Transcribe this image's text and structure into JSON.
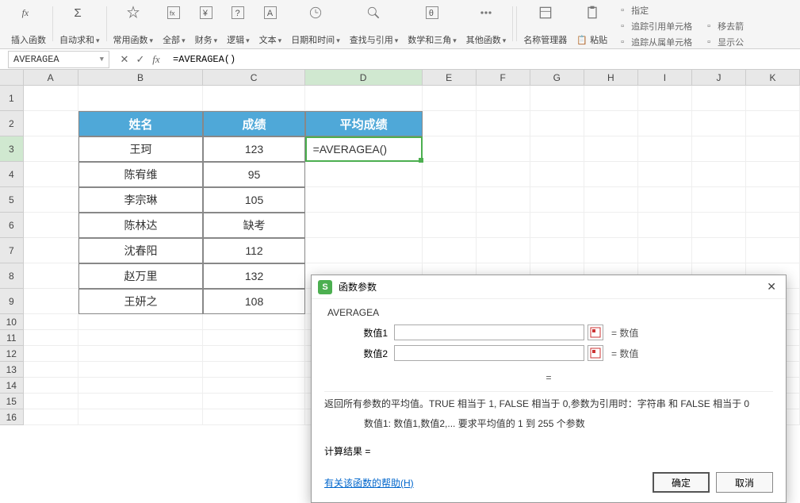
{
  "ribbon": {
    "items": [
      {
        "label": "插入函数",
        "icon": "fx"
      },
      {
        "label": "自动求和",
        "icon": "sigma",
        "drop": true
      },
      {
        "label": "常用函数",
        "icon": "star",
        "drop": true
      },
      {
        "label": "全部",
        "icon": "fxbox",
        "drop": true
      },
      {
        "label": "财务",
        "icon": "yen",
        "drop": true
      },
      {
        "label": "逻辑",
        "icon": "question",
        "drop": true
      },
      {
        "label": "文本",
        "icon": "textA",
        "drop": true
      },
      {
        "label": "日期和时间",
        "icon": "clock",
        "drop": true
      },
      {
        "label": "查找与引用",
        "icon": "search",
        "drop": true
      },
      {
        "label": "数学和三角",
        "icon": "theta",
        "drop": true
      },
      {
        "label": "其他函数",
        "icon": "dots",
        "drop": true
      }
    ],
    "right_main": {
      "label": "名称管理器",
      "icon": "book"
    },
    "right_paste": {
      "label": "粘贴",
      "icon": "paste"
    },
    "right_small": [
      {
        "label": "指定",
        "icon": "tag"
      },
      {
        "label": "追踪引用单元格",
        "icon": "trace-prec"
      },
      {
        "label": "移去箭",
        "icon": "remove-arrow"
      },
      {
        "label": "追踪从属单元格",
        "icon": "trace-dep"
      },
      {
        "label": "显示公",
        "icon": "show-formula"
      }
    ]
  },
  "name_box": "AVERAGEA",
  "formula": "=AVERAGEA()",
  "columns": [
    "A",
    "B",
    "C",
    "D",
    "E",
    "F",
    "G",
    "H",
    "I",
    "J",
    "K"
  ],
  "active_col": "D",
  "active_row": 3,
  "table": {
    "headers": {
      "b": "姓名",
      "c": "成绩",
      "d": "平均成绩"
    },
    "rows": [
      {
        "b": "王珂",
        "c": "123",
        "d": "=AVERAGEA()"
      },
      {
        "b": "陈宥维",
        "c": "95"
      },
      {
        "b": "李宗琳",
        "c": "105"
      },
      {
        "b": "陈林达",
        "c": "缺考"
      },
      {
        "b": "沈春阳",
        "c": "112"
      },
      {
        "b": "赵万里",
        "c": "132"
      },
      {
        "b": "王妍之",
        "c": "108"
      }
    ]
  },
  "dialog": {
    "title": "函数参数",
    "fn_name": "AVERAGEA",
    "params": [
      {
        "label": "数值1",
        "value": "",
        "hint": "数值"
      },
      {
        "label": "数值2",
        "value": "",
        "hint": "数值"
      }
    ],
    "eq": "=",
    "desc": "返回所有参数的平均值。TRUE 相当于 1, FALSE 相当于 0,参数为引用时：字符串 和 FALSE 相当于 0",
    "desc_sub": "数值1:  数值1,数值2,... 要求平均值的 1 到 255 个参数",
    "result_label": "计算结果 =",
    "help": "有关该函数的帮助(H)",
    "ok": "确定",
    "cancel": "取消"
  },
  "chart_data": {
    "type": "table",
    "title": "成绩表",
    "columns": [
      "姓名",
      "成绩",
      "平均成绩"
    ],
    "rows": [
      [
        "王珂",
        123,
        null
      ],
      [
        "陈宥维",
        95,
        null
      ],
      [
        "李宗琳",
        105,
        null
      ],
      [
        "陈林达",
        "缺考",
        null
      ],
      [
        "沈春阳",
        112,
        null
      ],
      [
        "赵万里",
        132,
        null
      ],
      [
        "王妍之",
        108,
        null
      ]
    ]
  }
}
